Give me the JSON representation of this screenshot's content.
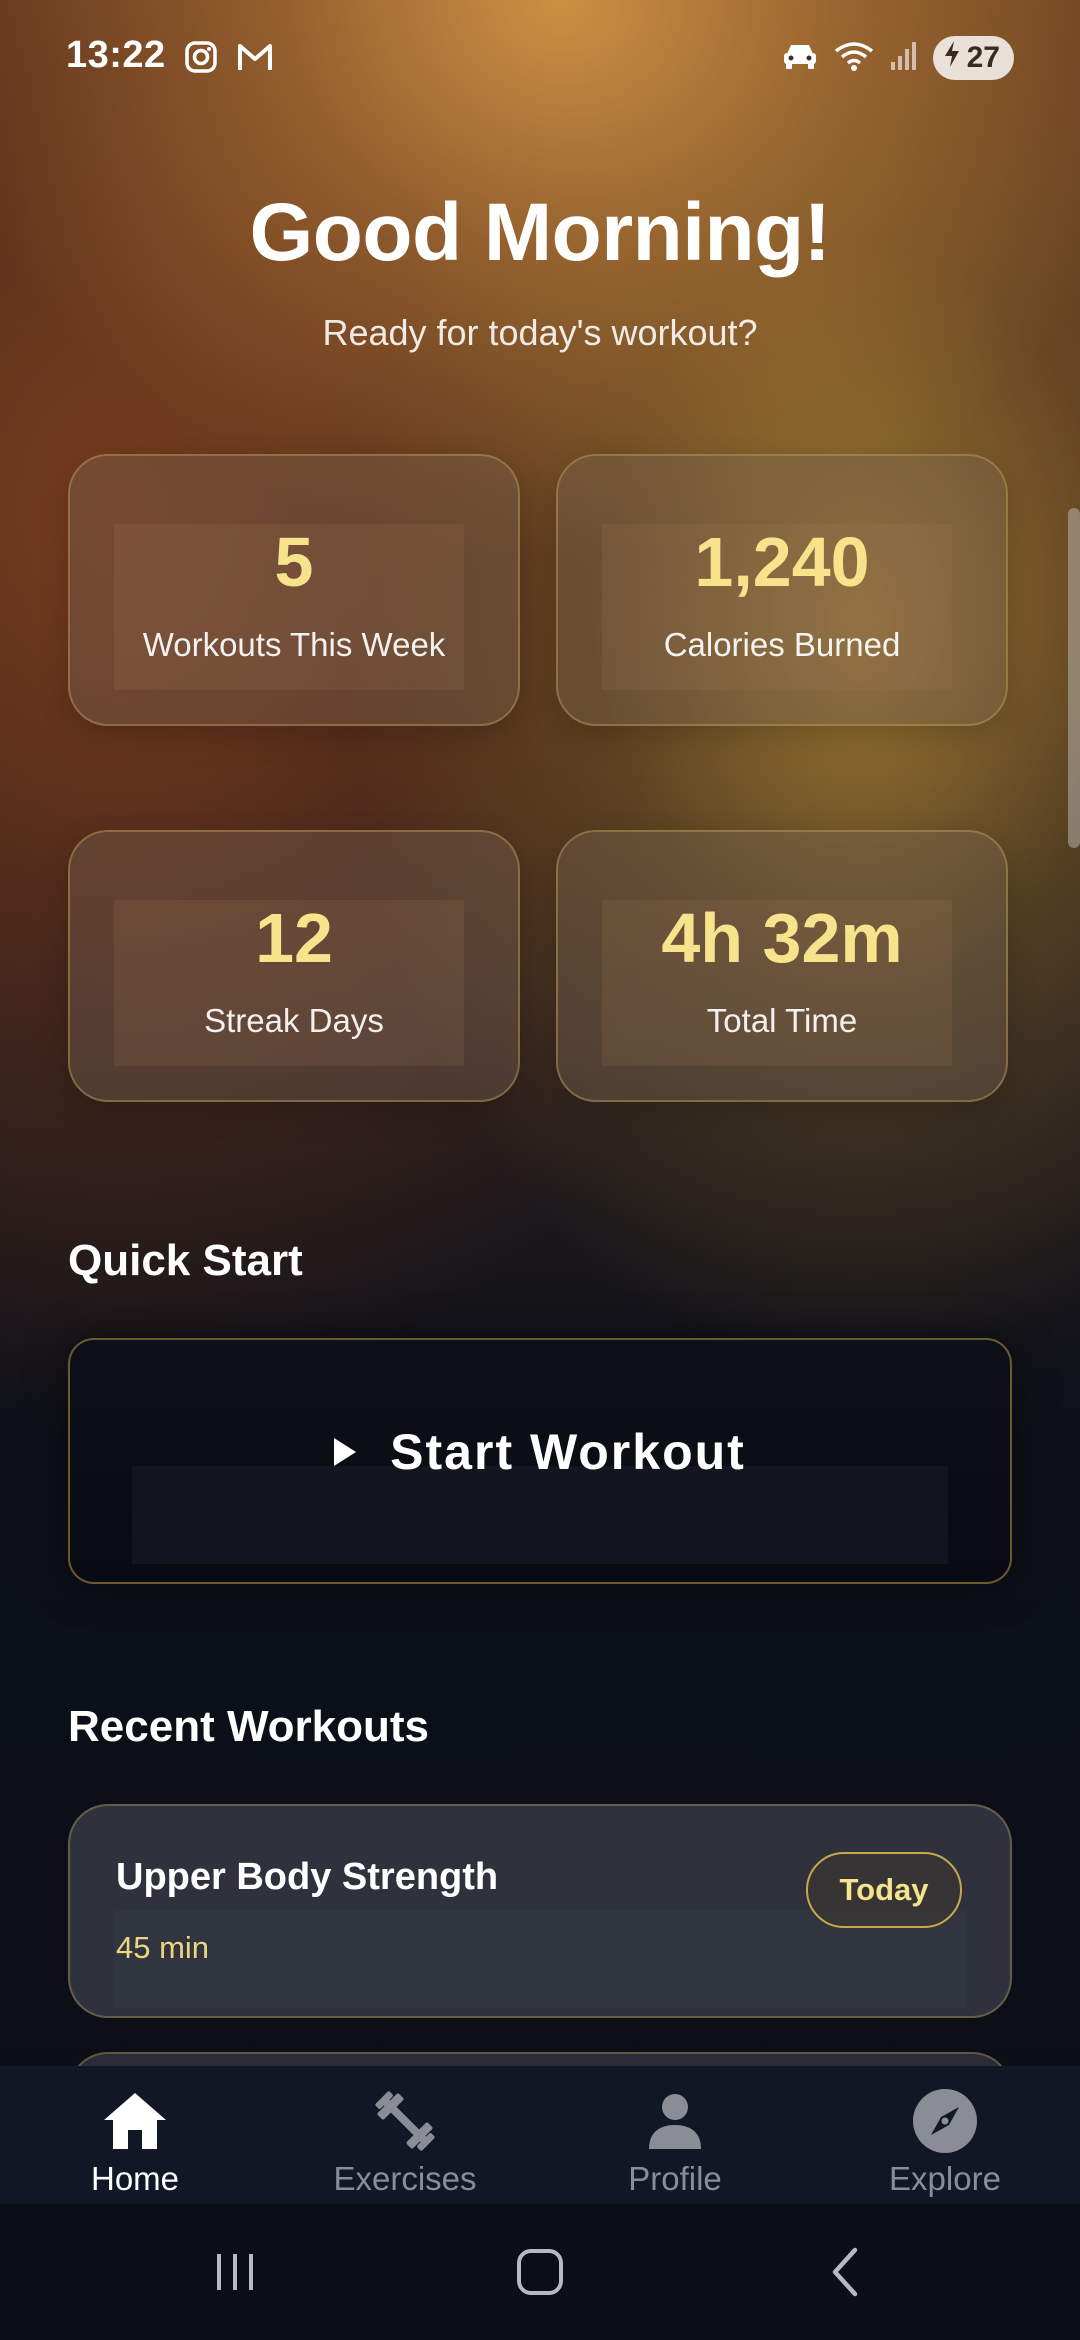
{
  "status_bar": {
    "time": "13:22",
    "battery": "27",
    "icons": [
      "instagram-icon",
      "gmail-icon",
      "car-icon",
      "wifi-icon",
      "signal-icon",
      "battery-charging-icon"
    ]
  },
  "header": {
    "greeting": "Good Morning!",
    "subtitle": "Ready for today's workout?"
  },
  "stats": [
    {
      "value": "5",
      "label": "Workouts This Week"
    },
    {
      "value": "1,240",
      "label": "Calories Burned"
    },
    {
      "value": "12",
      "label": "Streak Days"
    },
    {
      "value": "4h 32m",
      "label": "Total Time"
    }
  ],
  "quick_start": {
    "title": "Quick Start",
    "button_label": "Start Workout"
  },
  "recent": {
    "title": "Recent Workouts",
    "items": [
      {
        "name": "Upper Body Strength",
        "duration": "45 min",
        "badge": "Today"
      }
    ]
  },
  "bottom_nav": {
    "items": [
      {
        "label": "Home",
        "icon": "home-icon",
        "active": true
      },
      {
        "label": "Exercises",
        "icon": "dumbbell-icon",
        "active": false
      },
      {
        "label": "Profile",
        "icon": "person-icon",
        "active": false
      },
      {
        "label": "Explore",
        "icon": "compass-icon",
        "active": false
      }
    ]
  },
  "colors": {
    "accent": "#f6e38c",
    "card_border": "#c9a94a",
    "nav_background": "#121725",
    "page_background": "#0b0e16"
  }
}
